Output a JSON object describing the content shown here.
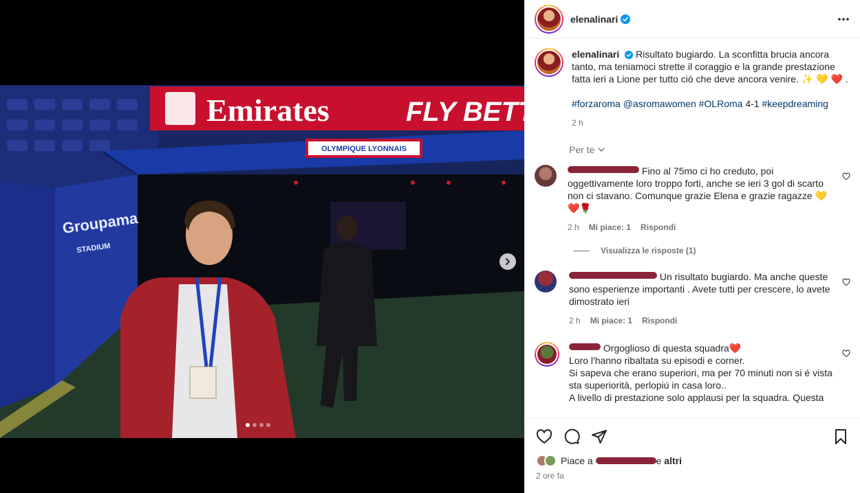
{
  "post": {
    "username": "elenalinari",
    "verified": true,
    "caption": "Risultato bugiardo. La sconfitta brucia ancora tanto, ma teniamoci strette il coraggio e la grande prestazione fatta ieri a Lione per tutto ciò che deve ancora venire. ✨ 💛 ❤️ .",
    "hashtags": [
      "#forzaroma",
      "@asromawomen",
      "#OLRoma"
    ],
    "score": "4-1",
    "hashtag_last": "#keepdreaming",
    "caption_time": "2 h",
    "for_you_label": "Per te",
    "likes_prefix": "Piace a",
    "likes_suffix": "e",
    "likes_others": "altri",
    "time_ago": "2 ore fa",
    "carousel": {
      "count": 4,
      "active_index": 0
    }
  },
  "photo": {
    "banner_text": "Emirates",
    "banner_text2": "FLY BETTE",
    "tunnel_sign": "OLYMPIQUE LYONNAIS",
    "stadium_sign": "Groupama",
    "stadium_sign2": "STADIUM"
  },
  "comments": [
    {
      "text": "Fino al 75mo ci ho creduto, poi oggettivamente loro troppo forti, anche se ieri 3 gol di scarto non ci stavano. Comunque grazie Elena e grazie ragazze 💛❤️🌹",
      "time": "2 h",
      "likes": "Mi piace: 1",
      "reply": "Rispondi",
      "view_replies": "Visualizza le risposte (1)"
    },
    {
      "text": "Un risultato bugiardo. Ma anche queste sono esperienze importanti . Avete tutti per crescere, lo avete dimostrato ieri",
      "time": "2 h",
      "likes": "Mi piace: 1",
      "reply": "Rispondi"
    },
    {
      "line1": "Orgoglioso di questa squadra❤️",
      "line2": "Loro l'hanno ribaltata su episodi e corner.",
      "line3": "Si sapeva che erano superiori, ma per 70 minuti non si é vista sta superiorità, perlopiú in casa loro..",
      "line4": "A livello di prestazione solo applausi per la squadra. Questa"
    }
  ],
  "colors": {
    "accent_link": "#00376b",
    "muted": "#737373",
    "verified": "#0095f6",
    "redaction": "#8a2438"
  }
}
